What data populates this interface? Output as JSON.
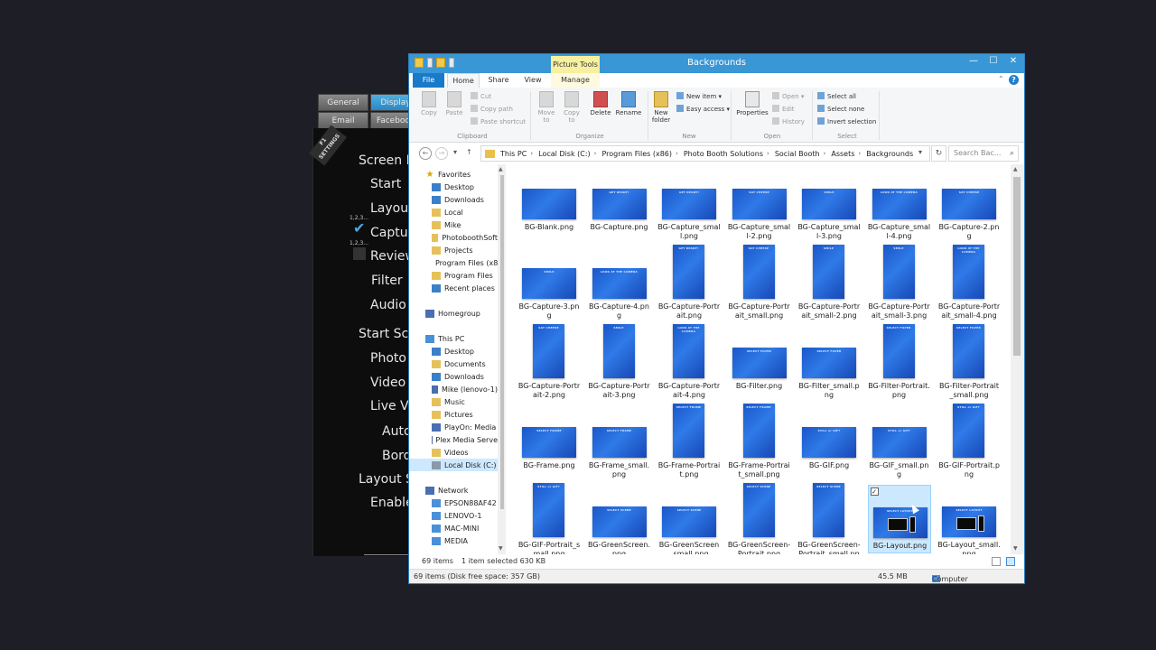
{
  "back_app": {
    "tabs": [
      "General",
      "Display",
      "Email",
      "Facebook"
    ],
    "settings_ribbon": "F1\nSETTINGS",
    "menu": [
      "Screen E",
      "Start",
      "Layout",
      "Captur",
      "Review",
      "Filter",
      "Audio",
      "Start Scr",
      "Photo",
      "Video",
      "Live Vi",
      "Auto",
      "Bord",
      "Layout S",
      "Enable"
    ],
    "mini_label": "1,2,3..."
  },
  "window": {
    "title": "Backgrounds",
    "picture_tools": "Picture Tools",
    "controls": {
      "minimize": "—",
      "maximize": "☐",
      "close": "✕"
    }
  },
  "ribbon_tabs": {
    "file": "File",
    "home": "Home",
    "share": "Share",
    "view": "View",
    "manage": "Manage"
  },
  "ribbon": {
    "clipboard": {
      "label": "Clipboard",
      "copy": "Copy",
      "paste": "Paste",
      "cut": "Cut",
      "copy_path": "Copy path",
      "paste_shortcut": "Paste shortcut"
    },
    "organize": {
      "label": "Organize",
      "move_to": "Move to",
      "copy_to": "Copy to",
      "delete": "Delete",
      "rename": "Rename"
    },
    "new": {
      "label": "New",
      "new_folder": "New folder",
      "new_item": "New item ▾",
      "easy_access": "Easy access ▾"
    },
    "open": {
      "label": "Open",
      "properties": "Properties",
      "open": "Open ▾",
      "edit": "Edit",
      "history": "History"
    },
    "select": {
      "label": "Select",
      "select_all": "Select all",
      "select_none": "Select none",
      "invert": "Invert selection"
    }
  },
  "address": {
    "crumbs": [
      "This PC",
      "Local Disk (C:)",
      "Program Files (x86)",
      "Photo Booth Solutions",
      "Social Booth",
      "Assets",
      "Backgrounds"
    ],
    "search_placeholder": "Search Bac..."
  },
  "nav": [
    {
      "label": "Favorites",
      "icon": "star",
      "level": 0
    },
    {
      "label": "Desktop",
      "icon": "blue",
      "level": 1
    },
    {
      "label": "Downloads",
      "icon": "blue",
      "level": 1
    },
    {
      "label": "Local",
      "icon": "folder",
      "level": 1
    },
    {
      "label": "Mike",
      "icon": "folder",
      "level": 1
    },
    {
      "label": "PhotoboothSoft",
      "icon": "folder",
      "level": 1
    },
    {
      "label": "Projects",
      "icon": "folder",
      "level": 1
    },
    {
      "label": "Program Files (x8",
      "icon": "folder",
      "level": 1
    },
    {
      "label": "Program Files",
      "icon": "folder",
      "level": 1
    },
    {
      "label": "Recent places",
      "icon": "blue",
      "level": 1
    },
    {
      "label": "Homegroup",
      "icon": "net",
      "level": 0
    },
    {
      "label": "This PC",
      "icon": "pc",
      "level": 0
    },
    {
      "label": "Desktop",
      "icon": "blue",
      "level": 1
    },
    {
      "label": "Documents",
      "icon": "folder",
      "level": 1
    },
    {
      "label": "Downloads",
      "icon": "blue",
      "level": 1
    },
    {
      "label": "Mike (lenovo-1)",
      "icon": "net",
      "level": 1
    },
    {
      "label": "Music",
      "icon": "folder",
      "level": 1
    },
    {
      "label": "Pictures",
      "icon": "folder",
      "level": 1
    },
    {
      "label": "PlayOn: Media",
      "icon": "net",
      "level": 1
    },
    {
      "label": "Plex Media Serve",
      "icon": "net",
      "level": 1
    },
    {
      "label": "Videos",
      "icon": "folder",
      "level": 1
    },
    {
      "label": "Local Disk (C:)",
      "icon": "disk",
      "level": 1,
      "selected": true
    },
    {
      "label": "Network",
      "icon": "net",
      "level": 0
    },
    {
      "label": "EPSON88AF42",
      "icon": "pc",
      "level": 1
    },
    {
      "label": "LENOVO-1",
      "icon": "pc",
      "level": 1
    },
    {
      "label": "MAC-MINI",
      "icon": "pc",
      "level": 1
    },
    {
      "label": "MEDIA",
      "icon": "pc",
      "level": 1
    }
  ],
  "files": [
    {
      "name": "BG-Blank.png",
      "orient": "land",
      "text": ""
    },
    {
      "name": "BG-Capture.png",
      "orient": "land",
      "text": "GET READY!"
    },
    {
      "name": "BG-Capture_small.png",
      "orient": "land",
      "text": "GET READY!"
    },
    {
      "name": "BG-Capture_small-2.png",
      "orient": "land",
      "text": "SAY CHEESE"
    },
    {
      "name": "BG-Capture_small-3.png",
      "orient": "land",
      "text": "SMILE"
    },
    {
      "name": "BG-Capture_small-4.png",
      "orient": "land",
      "text": "LOOK AT THE CAMERA"
    },
    {
      "name": "BG-Capture-2.png",
      "orient": "land",
      "text": "SAY CHEESE"
    },
    {
      "name": "BG-Capture-3.png",
      "orient": "land",
      "text": "SMILE"
    },
    {
      "name": "BG-Capture-4.png",
      "orient": "land",
      "text": "LOOK AT THE CAMERA"
    },
    {
      "name": "BG-Capture-Portrait.png",
      "orient": "port",
      "text": "GET READY!"
    },
    {
      "name": "BG-Capture-Portrait_small.png",
      "orient": "port",
      "text": "SAY CHEESE"
    },
    {
      "name": "BG-Capture-Portrait_small-2.png",
      "orient": "port",
      "text": "SMILE"
    },
    {
      "name": "BG-Capture-Portrait_small-3.png",
      "orient": "port",
      "text": "SMILE"
    },
    {
      "name": "BG-Capture-Portrait_small-4.png",
      "orient": "port",
      "text": "LOOK AT THE CAMERA"
    },
    {
      "name": "BG-Capture-Portrait-2.png",
      "orient": "port",
      "text": "SAY CHEESE"
    },
    {
      "name": "BG-Capture-Portrait-3.png",
      "orient": "port",
      "text": "SMILE"
    },
    {
      "name": "BG-Capture-Portrait-4.png",
      "orient": "port",
      "text": "LOOK AT THE CAMERA"
    },
    {
      "name": "BG-Filter.png",
      "orient": "land",
      "text": "SELECT FILTER"
    },
    {
      "name": "BG-Filter_small.png",
      "orient": "land",
      "text": "SELECT FILTER"
    },
    {
      "name": "BG-Filter-Portrait.png",
      "orient": "port",
      "text": "SELECT FILTER"
    },
    {
      "name": "BG-Filter-Portrait_small.png",
      "orient": "port",
      "text": "SELECT FILTER"
    },
    {
      "name": "BG-Frame.png",
      "orient": "land",
      "text": "SELECT FRAME"
    },
    {
      "name": "BG-Frame_small.png",
      "orient": "land",
      "text": "SELECT FRAME"
    },
    {
      "name": "BG-Frame-Portrait.png",
      "orient": "port",
      "text": "SELECT FRAME"
    },
    {
      "name": "BG-Frame-Portrait_small.png",
      "orient": "port",
      "text": "SELECT FRAME"
    },
    {
      "name": "BG-GIF.png",
      "orient": "land",
      "text": "STILL or GIF?"
    },
    {
      "name": "BG-GIF_small.png",
      "orient": "land",
      "text": "STILL or GIF?"
    },
    {
      "name": "BG-GIF-Portrait.png",
      "orient": "port",
      "text": "STILL or GIF?"
    },
    {
      "name": "BG-GIF-Portrait_small.png",
      "orient": "port",
      "text": "STILL or GIF?"
    },
    {
      "name": "BG-GreenScreen.png",
      "orient": "land",
      "text": "SELECT SCENE"
    },
    {
      "name": "BG-GreenScreen_small.png",
      "orient": "land",
      "text": "SELECT SCENE"
    },
    {
      "name": "BG-GreenScreen-Portrait.png",
      "orient": "port",
      "text": "SELECT SCENE"
    },
    {
      "name": "BG-GreenScreen-Portrait_small.png",
      "orient": "port",
      "text": "SELECT SCENE"
    },
    {
      "name": "BG-Layout.png",
      "orient": "land",
      "text": "SELECT LAYOUT",
      "layout": true,
      "selected": true
    },
    {
      "name": "BG-Layout_small.png",
      "orient": "land",
      "text": "SELECT LAYOUT",
      "layout": true
    }
  ],
  "status": {
    "items": "69 items",
    "selected": "1 item selected  630 KB"
  },
  "details": {
    "left": "69 items (Disk free space: 357 GB)",
    "size": "45.5 MB",
    "location": "Computer"
  }
}
